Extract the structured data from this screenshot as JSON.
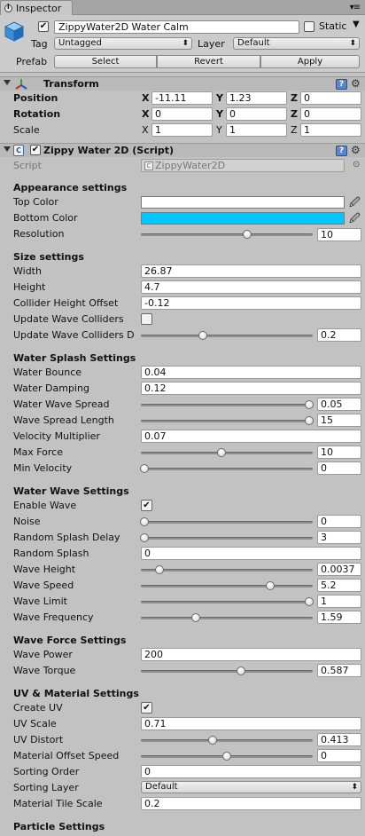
{
  "window": {
    "tab_label": "Inspector"
  },
  "header": {
    "object_name": "ZippyWater2D Water Calm",
    "active_checked": true,
    "static_label": "Static",
    "static_checked": false,
    "tag_label": "Tag",
    "tag_value": "Untagged",
    "layer_label": "Layer",
    "layer_value": "Default",
    "prefab_label": "Prefab",
    "select_label": "Select",
    "revert_label": "Revert",
    "apply_label": "Apply"
  },
  "transform": {
    "title": "Transform",
    "position_label": "Position",
    "rotation_label": "Rotation",
    "scale_label": "Scale",
    "axis_x": "X",
    "axis_y": "Y",
    "axis_z": "Z",
    "position": {
      "x": "-11.11",
      "y": "1.23",
      "z": "0"
    },
    "rotation": {
      "x": "0",
      "y": "0",
      "z": "0"
    },
    "scale": {
      "x": "1",
      "y": "1",
      "z": "1"
    }
  },
  "component": {
    "title": "Zippy Water 2D (Script)",
    "enabled": true,
    "script_label": "Script",
    "script_value": "ZippyWater2D",
    "appearance": {
      "title": "Appearance settings",
      "top_color_label": "Top Color",
      "top_color": "#ffffff",
      "bottom_color_label": "Bottom Color",
      "bottom_color": "#00c8ff",
      "resolution_label": "Resolution",
      "resolution": "10",
      "resolution_slider": 0.62
    },
    "size": {
      "title": "Size settings",
      "width_label": "Width",
      "width": "26.87",
      "height_label": "Height",
      "height": "4.7",
      "collider_offset_label": "Collider Height Offset",
      "collider_offset": "-0.12",
      "update_colliders_label": "Update Wave Colliders",
      "update_colliders_checked": false,
      "update_colliders_d_label": "Update Wave Colliders D",
      "update_colliders_d": "0.2",
      "update_colliders_d_slider": 0.36
    },
    "splash": {
      "title": "Water Splash Settings",
      "bounce_label": "Water Bounce",
      "bounce": "0.04",
      "damping_label": "Water Damping",
      "damping": "0.12",
      "wave_spread_label": "Water Wave Spread",
      "wave_spread": "0.05",
      "wave_spread_slider": 0.98,
      "spread_length_label": "Wave Spread Length",
      "spread_length": "15",
      "spread_length_slider": 0.98,
      "velocity_label": "Velocity Multiplier",
      "velocity": "0.07",
      "max_force_label": "Max Force",
      "max_force": "10",
      "max_force_slider": 0.47,
      "min_velocity_label": "Min Velocity",
      "min_velocity": "0",
      "min_velocity_slider": 0.02
    },
    "wave": {
      "title": "Water Wave Settings",
      "enable_label": "Enable Wave",
      "enable_checked": true,
      "noise_label": "Noise",
      "noise": "0",
      "noise_slider": 0.02,
      "splash_delay_label": "Random Splash Delay",
      "splash_delay": "3",
      "splash_delay_slider": 0.02,
      "random_splash_label": "Random Splash",
      "random_splash": "0",
      "height_label": "Wave Height",
      "height": "0.0037",
      "height_slider": 0.11,
      "speed_label": "Wave Speed",
      "speed": "5.2",
      "speed_slider": 0.75,
      "limit_label": "Wave Limit",
      "limit": "1",
      "limit_slider": 0.98,
      "frequency_label": "Wave Frequency",
      "frequency": "1.59",
      "frequency_slider": 0.32
    },
    "force": {
      "title": "Wave Force Settings",
      "power_label": "Wave Power",
      "power": "200",
      "torque_label": "Wave Torque",
      "torque": "0.587",
      "torque_slider": 0.58
    },
    "uv": {
      "title": "UV & Material Settings",
      "create_uv_label": "Create UV",
      "create_uv_checked": true,
      "uv_scale_label": "UV Scale",
      "uv_scale": "0.71",
      "uv_distort_label": "UV Distort",
      "uv_distort": "0.413",
      "uv_distort_slider": 0.42,
      "offset_speed_label": "Material Offset Speed",
      "offset_speed": "0",
      "offset_speed_slider": 0.5,
      "sorting_order_label": "Sorting Order",
      "sorting_order": "0",
      "sorting_layer_label": "Sorting Layer",
      "sorting_layer": "Default",
      "tile_scale_label": "Material Tile Scale",
      "tile_scale": "0.2"
    },
    "particle": {
      "title": "Particle Settings"
    }
  },
  "icons": {
    "check_glyph": "✔",
    "dropdown_glyph": "⬍",
    "fold_glyph": "▼",
    "help_glyph": "?",
    "gear_glyph": "⚙",
    "picker_glyph": "🖉",
    "target_glyph": "⊙",
    "menu_glyph": "▾≡"
  }
}
